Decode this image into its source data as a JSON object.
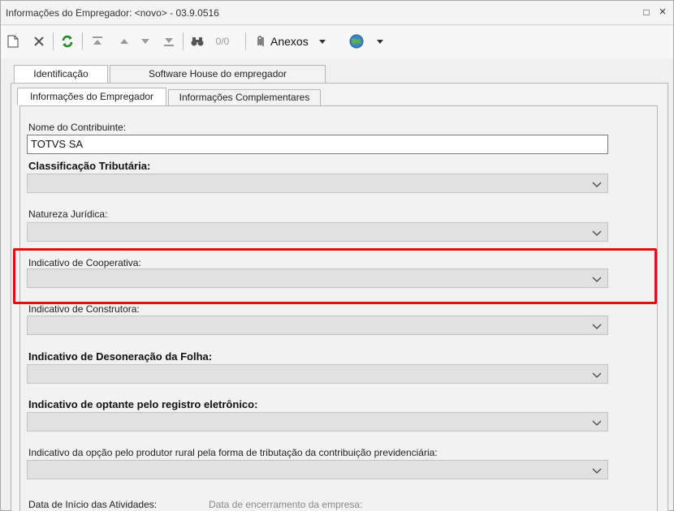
{
  "window": {
    "title": "Informações do Empregador: <novo> - 03.9.0516",
    "controls": {
      "restore": "□",
      "close": "×"
    }
  },
  "toolbar": {
    "counter": "0/0",
    "attachments_label": "Anexos",
    "icons": [
      "new-doc-icon",
      "delete-icon",
      "refresh-icon",
      "first-record-icon",
      "previous-record-icon",
      "next-record-icon",
      "last-record-icon",
      "binoculars-icon",
      "paperclip-icon",
      "globe-icon"
    ]
  },
  "tabs": {
    "top": [
      {
        "label": "Identificação",
        "active": true
      },
      {
        "label": "Software House do empregador",
        "active": false
      }
    ],
    "sub": [
      {
        "label": "Informações do Empregador",
        "active": true
      },
      {
        "label": "Informações Complementares",
        "active": false
      }
    ]
  },
  "form": {
    "nome_contribuinte": {
      "label": "Nome do Contribuinte:",
      "value": "TOTVS SA"
    },
    "classificacao_tributaria": {
      "label": "Classificação Tributária:",
      "value": ""
    },
    "natureza_juridica": {
      "label": "Natureza Jurídica:",
      "value": ""
    },
    "indicativo_cooperativa": {
      "label": "Indicativo de Cooperativa:",
      "value": "",
      "highlighted": true
    },
    "indicativo_construtora": {
      "label": "Indicativo de Construtora:",
      "value": ""
    },
    "indicativo_desoneracao": {
      "label": "Indicativo de Desoneração da Folha:",
      "value": ""
    },
    "indicativo_registro_eletronico": {
      "label": "Indicativo de optante pelo registro eletrônico:",
      "value": ""
    },
    "indicativo_produtor_rural": {
      "label": "Indicativo da opção pelo produtor rural pela forma de tributação da contribuição previdenciária:",
      "value": ""
    },
    "data_inicio": {
      "label": "Data de Início das Atividades:"
    },
    "data_encerramento": {
      "label": "Data de encerramento da empresa:"
    }
  },
  "colors": {
    "highlight": "#e01010",
    "combo_bg": "#e1e1e1",
    "window_bg": "#f0f0f0"
  }
}
